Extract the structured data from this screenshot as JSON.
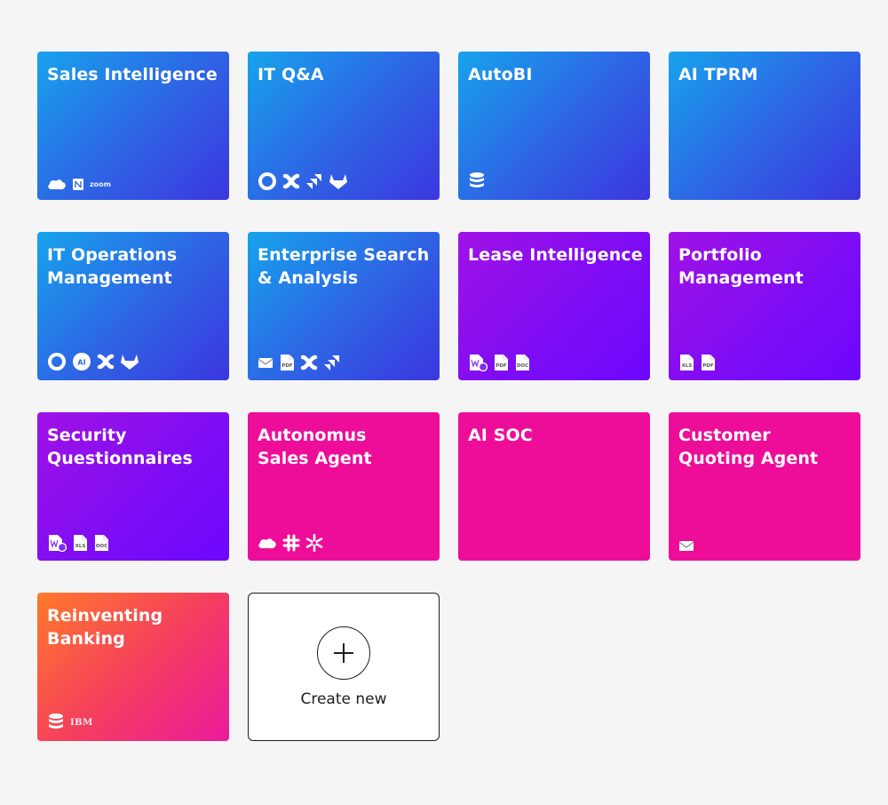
{
  "cards": [
    {
      "title": "Sales Intelligence",
      "theme": "blue",
      "logos": [
        "salesforce-icon",
        "notion-icon",
        "zoom-icon"
      ],
      "zoom_text": "zoom"
    },
    {
      "title": "IT Q&A",
      "theme": "blue",
      "logos": [
        "okta-icon",
        "confluence-icon",
        "jira-icon",
        "gitlab-icon"
      ]
    },
    {
      "title": "AutoBI",
      "theme": "blue",
      "logos": [
        "database-icon"
      ]
    },
    {
      "title": "AI TPRM",
      "theme": "blue",
      "logos": []
    },
    {
      "title": "IT Operations\nManagement",
      "theme": "blue",
      "logos": [
        "okta-icon",
        "ai-icon",
        "confluence-icon",
        "gitlab-icon"
      ]
    },
    {
      "title": "Enterprise Search\n& Analysis",
      "theme": "blue",
      "logos": [
        "mail-icon",
        "pdf-icon",
        "confluence-icon",
        "jira-icon"
      ]
    },
    {
      "title": "Lease Intelligence",
      "theme": "purple",
      "logos": [
        "word-file-icon",
        "pdf-icon",
        "doc-icon"
      ]
    },
    {
      "title": "Portfolio\nManagement",
      "theme": "purple",
      "logos": [
        "xls-icon",
        "pdf-icon"
      ]
    },
    {
      "title": "Security\nQuestionnaires",
      "theme": "purple",
      "logos": [
        "word-file-icon",
        "xls-icon",
        "doc-icon"
      ]
    },
    {
      "title": "Autonomus\nSales Agent",
      "theme": "pink",
      "logos": [
        "salesforce-icon",
        "slack-icon",
        "snowflake-icon"
      ]
    },
    {
      "title": "AI SOC",
      "theme": "pink",
      "logos": []
    },
    {
      "title": "Customer\nQuoting Agent",
      "theme": "pink",
      "logos": [
        "mail-icon"
      ]
    },
    {
      "title": "Reinventing\nBanking",
      "theme": "orange",
      "logos": [
        "database-icon",
        "ibm-icon"
      ],
      "ibm_text": "IBM"
    }
  ],
  "create": {
    "label": "Create new"
  },
  "file_labels": {
    "pdf": "PDF",
    "doc": "DOC",
    "xls": "XLS"
  },
  "colors": {
    "blue_start": "#16a3ec",
    "blue_end": "#3b37df",
    "purple": "#7c0cf5",
    "pink": "#ee0d98",
    "orange": "#ff7a2a",
    "background": "#f5f5f6"
  }
}
